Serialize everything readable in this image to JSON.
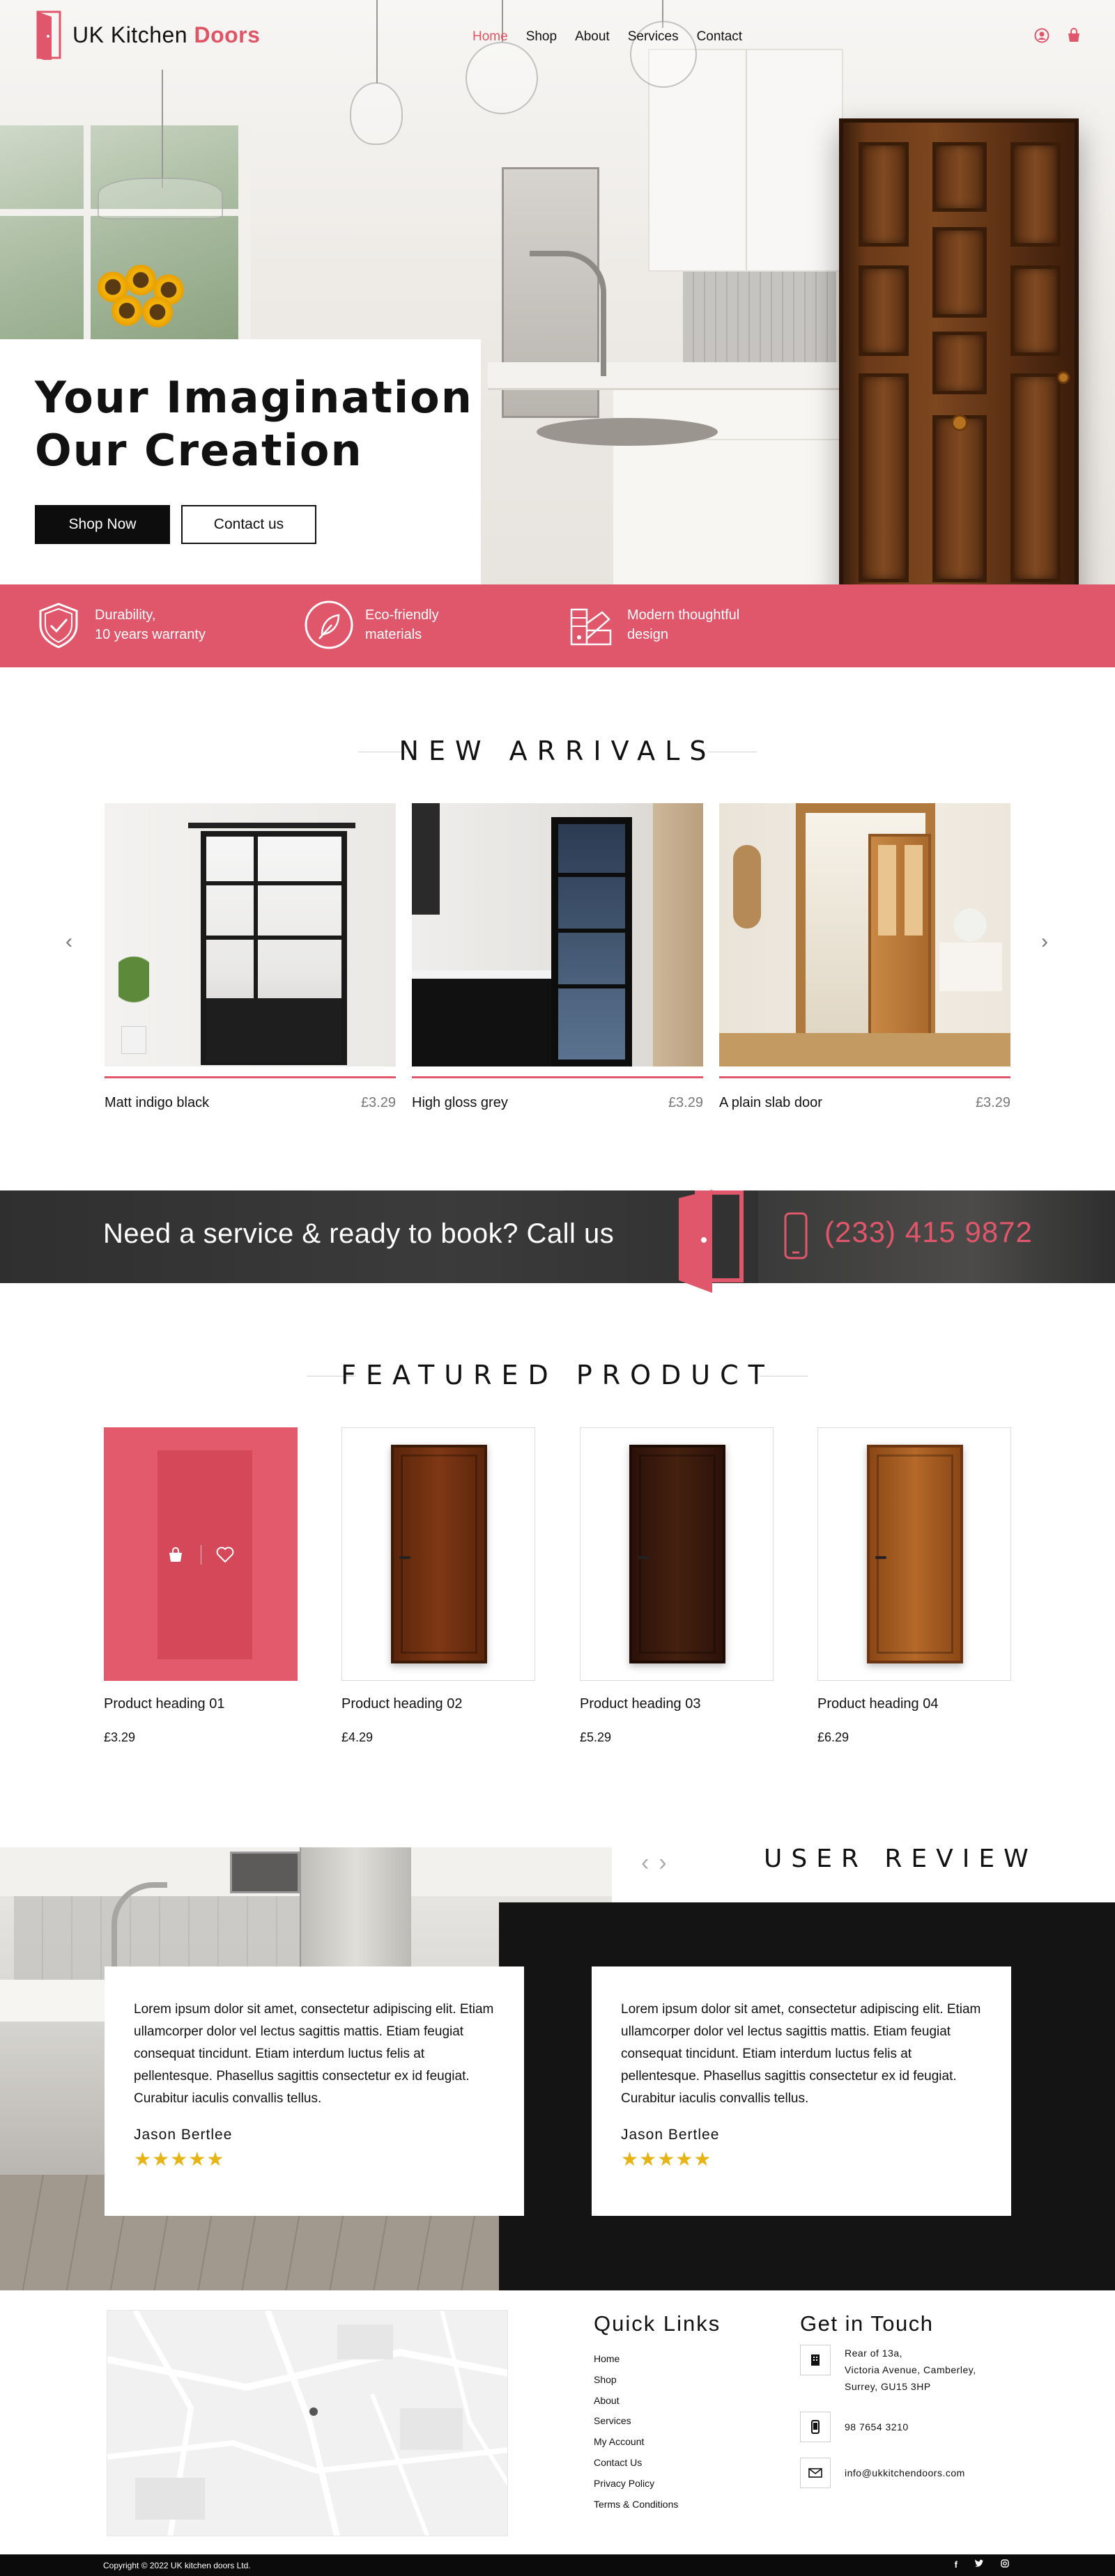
{
  "brand": {
    "name_part1": "UK Kitchen",
    "name_part2": "Doors",
    "accent": "#e0566a"
  },
  "nav": {
    "links": [
      {
        "label": "Home",
        "active": true
      },
      {
        "label": "Shop"
      },
      {
        "label": "About"
      },
      {
        "label": "Services"
      },
      {
        "label": "Contact"
      }
    ],
    "icons": [
      "user-icon",
      "shopping-bag-icon"
    ]
  },
  "hero": {
    "title_line1": "Your Imagination",
    "title_line2": "Our Creation",
    "primary_button": "Shop Now",
    "secondary_button": "Contact us"
  },
  "features": [
    {
      "icon": "shield-check-icon",
      "line1": "Durability,",
      "line2": "10 years warranty"
    },
    {
      "icon": "leaf-icon",
      "line1": "Eco-friendly",
      "line2": "materials"
    },
    {
      "icon": "design-swatch-icon",
      "line1": "Modern thoughtful",
      "line2": "design"
    }
  ],
  "new_arrivals": {
    "title": "NEW ARRIVALS",
    "items": [
      {
        "name": "Matt indigo black",
        "price": "£3.29"
      },
      {
        "name": "High gloss grey",
        "price": "£3.29"
      },
      {
        "name": "A plain slab door",
        "price": "£3.29"
      }
    ]
  },
  "call_banner": {
    "text": "Need a service & ready to book? Call us",
    "phone": "(233) 415 9872"
  },
  "featured": {
    "title": "FEATURED PRODUCT",
    "items": [
      {
        "name": "Product heading 01",
        "price": "£3.29"
      },
      {
        "name": "Product heading 02",
        "price": "£4.29"
      },
      {
        "name": "Product heading 03",
        "price": "£5.29"
      },
      {
        "name": "Product heading 04",
        "price": "£6.29"
      }
    ]
  },
  "reviews": {
    "title": "USER REVIEW",
    "items": [
      {
        "text": "Lorem ipsum dolor sit amet, consectetur adipiscing elit. Etiam ullamcorper dolor vel lectus sagittis mattis. Etiam feugiat consequat tincidunt. Etiam interdum luctus felis at pellentesque. Phasellus sagittis consectetur ex id feugiat. Curabitur iaculis convallis tellus.",
        "name": "Jason Bertlee",
        "stars": "★★★★★"
      },
      {
        "text": "Lorem ipsum dolor sit amet, consectetur adipiscing elit. Etiam ullamcorper dolor vel lectus sagittis mattis. Etiam feugiat consequat tincidunt. Etiam interdum luctus felis at pellentesque. Phasellus sagittis consectetur ex id feugiat. Curabitur iaculis convallis tellus.",
        "name": "Jason Bertlee",
        "stars": "★★★★★"
      }
    ]
  },
  "footer": {
    "quick_links_title": "Quick Links",
    "quick_links": [
      "Home",
      "Shop",
      "About",
      "Services",
      "My Account",
      "Contact Us",
      "Privacy Policy",
      "Terms & Conditions"
    ],
    "contact_title": "Get in Touch",
    "address_line1": "Rear of 13a,",
    "address_line2": "Victoria Avenue, Camberley,",
    "address_line3": "Surrey, GU15 3HP",
    "phone": "98 7654 3210",
    "email": "info@ukkitchendoors.com",
    "copyright": "Copyright © 2022 UK kitchen doors Ltd."
  }
}
